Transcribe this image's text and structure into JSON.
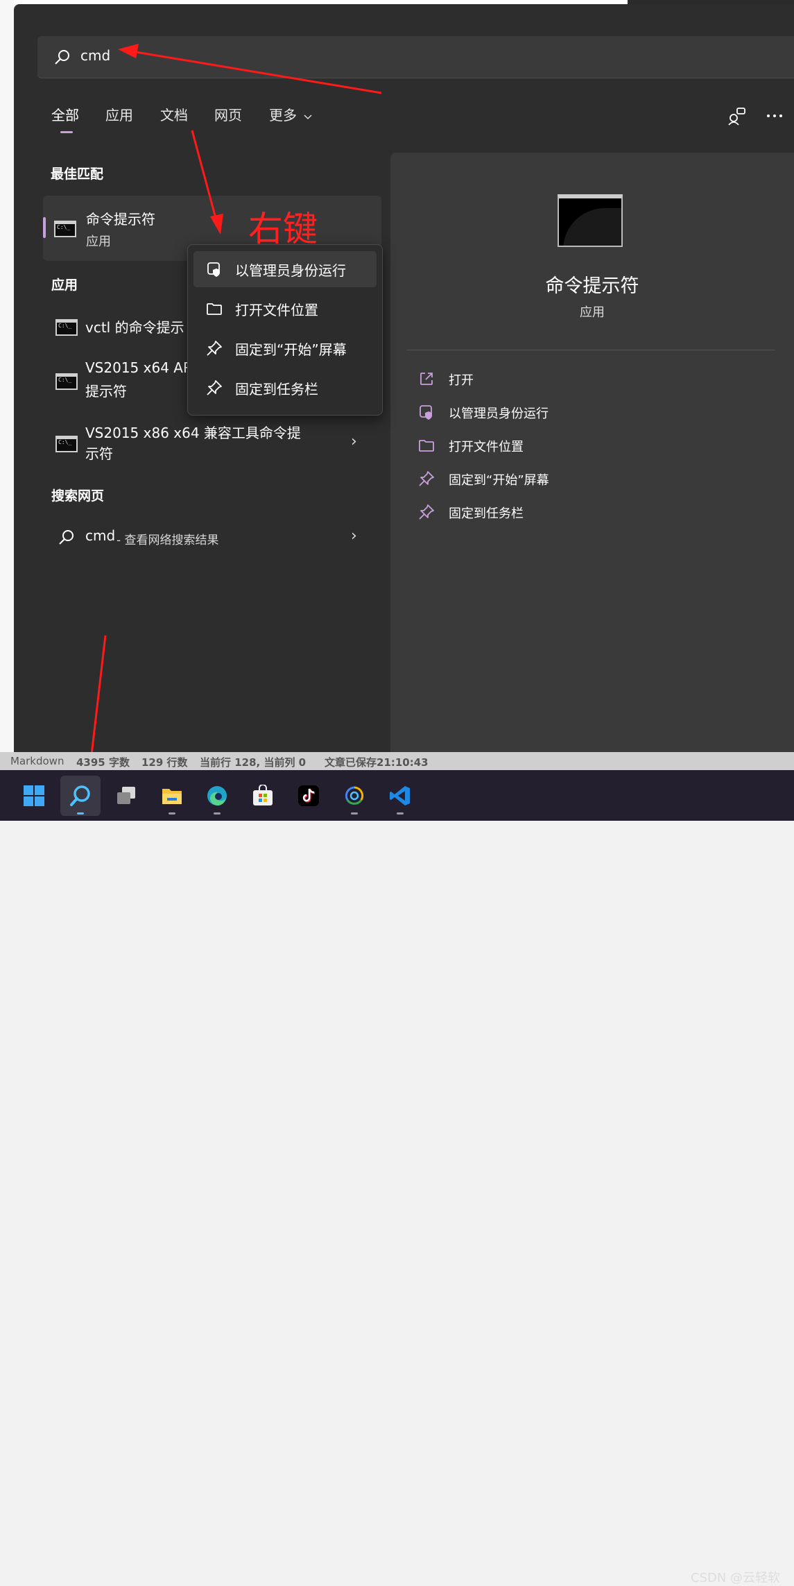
{
  "search": {
    "query": "cmd"
  },
  "tabs": [
    {
      "label": "全部"
    },
    {
      "label": "应用"
    },
    {
      "label": "文档"
    },
    {
      "label": "网页"
    },
    {
      "label": "更多"
    }
  ],
  "sections": {
    "best_match": "最佳匹配",
    "apps": "应用",
    "web": "搜索网页"
  },
  "best_match": {
    "title": "命令提示符",
    "subtitle": "应用"
  },
  "apps": [
    {
      "line1": "vctl 的命令提示",
      "line2": ""
    },
    {
      "line1": "VS2015 x64 AR",
      "line2": "提示符"
    },
    {
      "line1": "VS2015 x86 x64 兼容工具命令提",
      "line2": "示符"
    }
  ],
  "web": {
    "query": "cmd",
    "suffix": " - 查看网络搜索结果"
  },
  "context_menu": [
    {
      "label": "以管理员身份运行",
      "icon": "shield-icon"
    },
    {
      "label": "打开文件位置",
      "icon": "folder-icon"
    },
    {
      "label": "固定到“开始”屏幕",
      "icon": "pin-icon"
    },
    {
      "label": "固定到任务栏",
      "icon": "pin-icon"
    }
  ],
  "annotation": "右键",
  "preview": {
    "title": "命令提示符",
    "subtitle": "应用"
  },
  "actions": [
    {
      "label": "打开",
      "icon": "open-external-icon"
    },
    {
      "label": "以管理员身份运行",
      "icon": "shield-icon"
    },
    {
      "label": "打开文件位置",
      "icon": "folder-icon"
    },
    {
      "label": "固定到“开始”屏幕",
      "icon": "pin-icon"
    },
    {
      "label": "固定到任务栏",
      "icon": "pin-icon"
    }
  ],
  "statusbar": {
    "mode": "Markdown",
    "chars": "4395 字数",
    "lines": "129 行数",
    "position": "当前行 128, 当前列 0",
    "saved": "文章已保存21:10:43"
  },
  "taskbar": [
    "windows-start",
    "search",
    "task-view",
    "file-explorer",
    "edge",
    "microsoft-store",
    "tiktok",
    "app-swirl",
    "vscode"
  ],
  "watermark": "CSDN @云轻软",
  "colors": {
    "accent": "#c9a0dc",
    "annotation": "#ff2020",
    "taskbar": "#231f2e"
  }
}
